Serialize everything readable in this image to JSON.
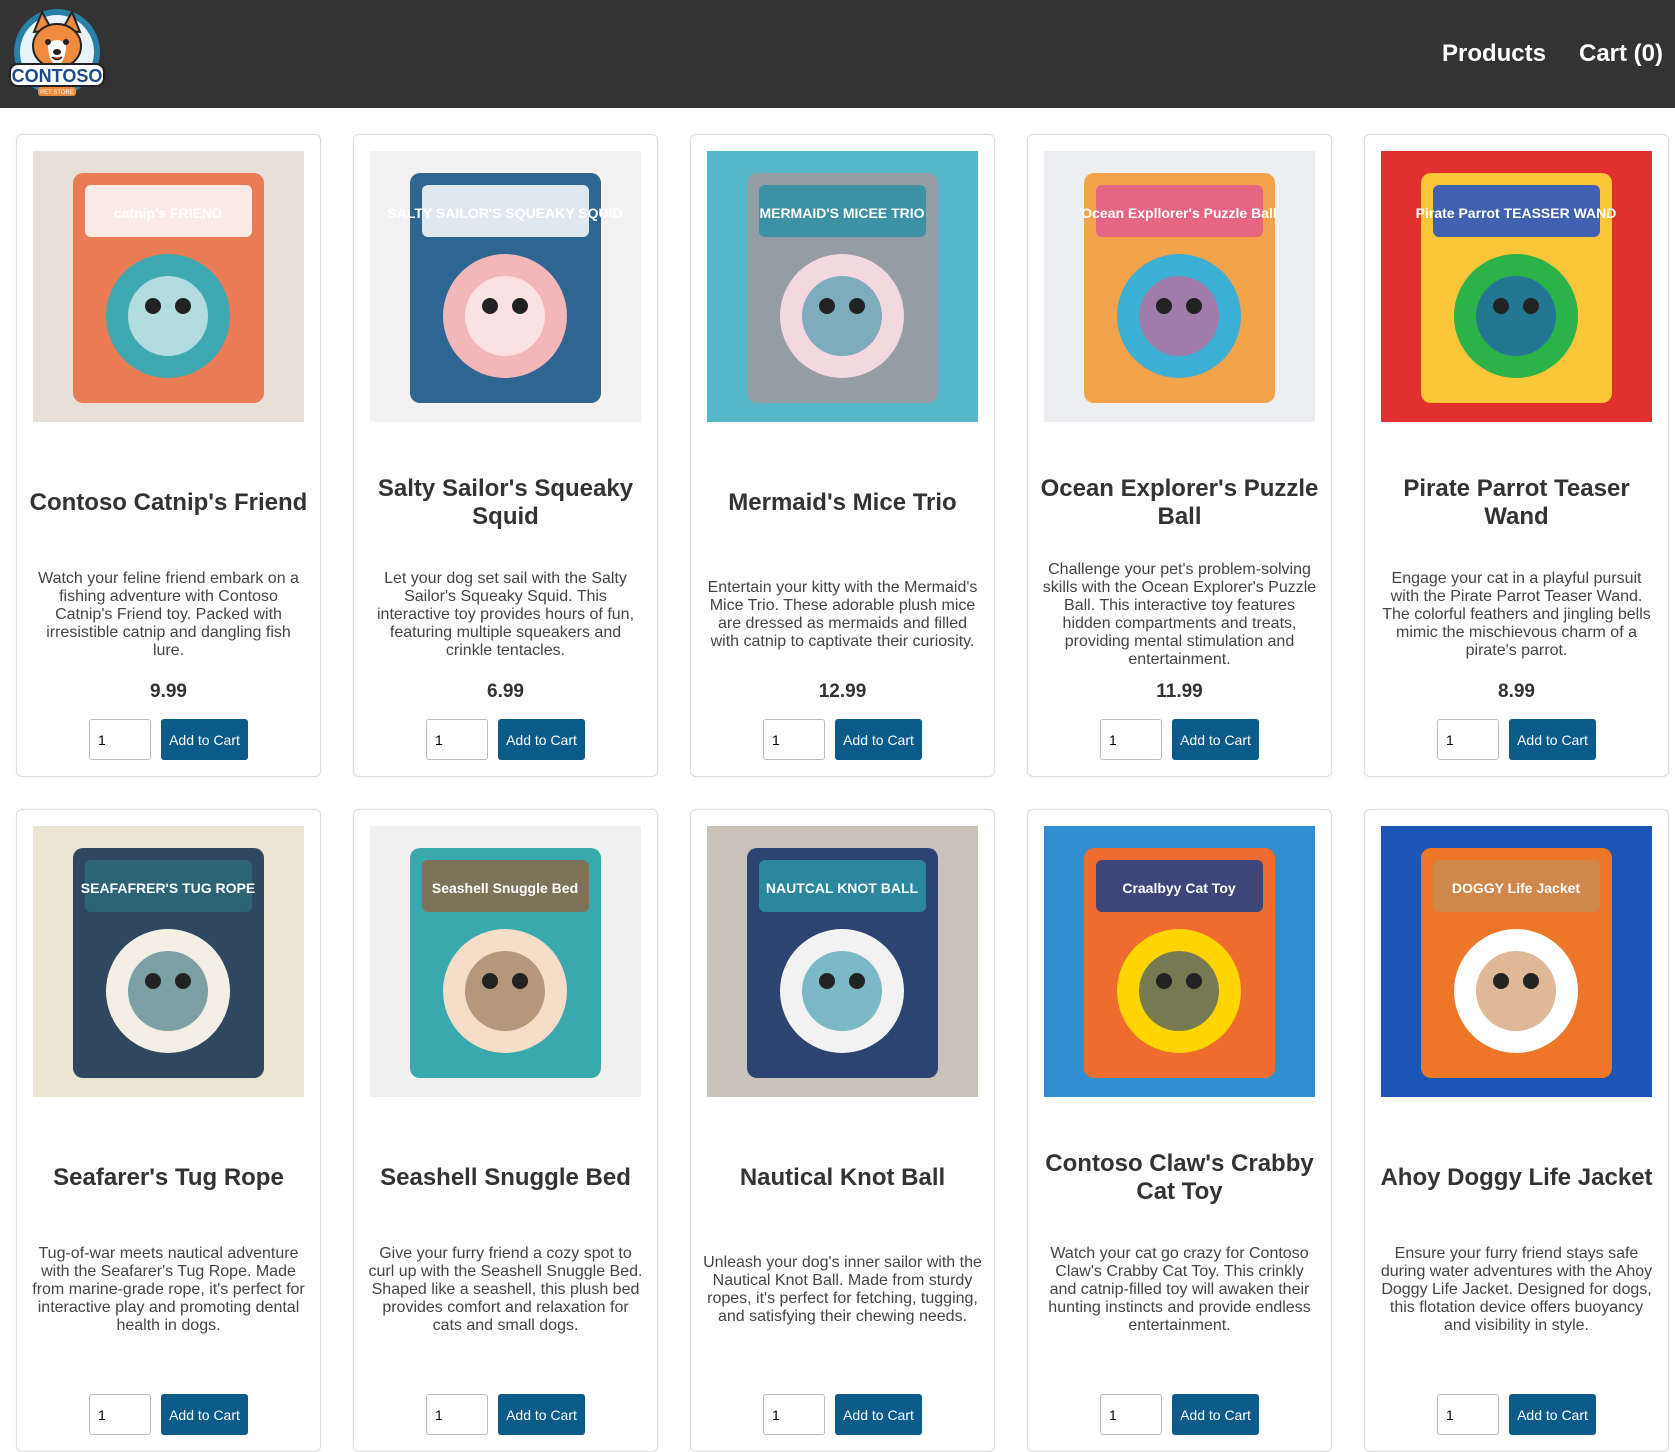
{
  "header": {
    "logo_text": "CONTOSO",
    "logo_subtext": "PET STORE",
    "nav": [
      {
        "label": "Products"
      },
      {
        "label": "Cart (0)"
      }
    ]
  },
  "products": [
    {
      "title": "Contoso Catnip's Friend",
      "description": "Watch your feline friend embark on a fishing adventure with Contoso Catnip's Friend toy. Packed with irresistible catnip and dangling fish lure.",
      "price": "9.99",
      "quantity": "1",
      "add_label": "Add to Cart",
      "image": {
        "palette": [
          "#e8e0d8",
          "#e6734a",
          "#3fa9b2",
          "#ffffff"
        ],
        "icon": "cat-ball-toy-icon",
        "package_text": "catnip's FRIEND"
      }
    },
    {
      "title": "Salty Sailor's Squeaky Squid",
      "description": "Let your dog set sail with the Salty Sailor's Squeaky Squid. This interactive toy provides hours of fun, featuring multiple squeakers and crinkle tentacles.",
      "price": "6.99",
      "quantity": "1",
      "add_label": "Add to Cart",
      "image": {
        "palette": [
          "#f2f2f2",
          "#1d5a8a",
          "#f3b6b9",
          "#ffffff"
        ],
        "icon": "squid-toy-icon",
        "package_text": "SALTY SAILOR'S SQUEAKY SQUID"
      }
    },
    {
      "title": "Mermaid's Mice Trio",
      "description": "Entertain your kitty with the Mermaid's Mice Trio. These adorable plush mice are dressed as mermaids and filled with catnip to captivate their curiosity.",
      "price": "12.99",
      "quantity": "1",
      "add_label": "Add to Cart",
      "image": {
        "palette": [
          "#55b7c9",
          "#9a9aa0",
          "#f4d8e0",
          "#2d8fa5"
        ],
        "icon": "mermaid-mice-icon",
        "package_text": "MERMAID'S MICEE TRIO"
      }
    },
    {
      "title": "Ocean Explorer's Puzzle Ball",
      "description": "Challenge your pet's problem-solving skills with the Ocean Explorer's Puzzle Ball. This interactive toy features hidden compartments and treats, providing mental stimulation and entertainment.",
      "price": "11.99",
      "quantity": "1",
      "add_label": "Add to Cart",
      "image": {
        "palette": [
          "#eceef2",
          "#f39c3c",
          "#3bb0d4",
          "#e25a8c"
        ],
        "icon": "puzzle-ball-icon",
        "package_text": "Ocean Expllorer's Puzzle Ball"
      }
    },
    {
      "title": "Pirate Parrot Teaser Wand",
      "description": "Engage your cat in a playful pursuit with the Pirate Parrot Teaser Wand. The colorful feathers and jingling bells mimic the mischievous charm of a pirate's parrot.",
      "price": "8.99",
      "quantity": "1",
      "add_label": "Add to Cart",
      "image": {
        "palette": [
          "#e0312f",
          "#ffd23a",
          "#2bb34a",
          "#1e4fc4"
        ],
        "icon": "feather-wand-icon",
        "package_text": "Pirate Parrot TEASSER WAND"
      }
    },
    {
      "title": "Seafarer's Tug Rope",
      "description": "Tug-of-war meets nautical adventure with the Seafarer's Tug Rope. Made from marine-grade rope, it's perfect for interactive play and promoting dental health in dogs.",
      "price": "",
      "quantity": "1",
      "add_label": "Add to Cart",
      "image": {
        "palette": [
          "#ece4d2",
          "#1e3b56",
          "#f4efe4",
          "#2b6a7a"
        ],
        "icon": "rope-toy-icon",
        "package_text": "SEAFAFRER'S TUG ROPE"
      }
    },
    {
      "title": "Seashell Snuggle Bed",
      "description": "Give your furry friend a cozy spot to curl up with the Seashell Snuggle Bed. Shaped like a seashell, this plush bed provides comfort and relaxation for cats and small dogs.",
      "price": "",
      "quantity": "1",
      "add_label": "Add to Cart",
      "image": {
        "palette": [
          "#f0f0f0",
          "#2aa3a8",
          "#f6ddc8",
          "#8a6a4a"
        ],
        "icon": "shell-bed-icon",
        "package_text": "Seashell Snuggle Bed"
      }
    },
    {
      "title": "Nautical Knot Ball",
      "description": "Unleash your dog's inner sailor with the Nautical Knot Ball. Made from sturdy ropes, it's perfect for fetching, tugging, and satisfying their chewing needs.",
      "price": "",
      "quantity": "1",
      "add_label": "Add to Cart",
      "image": {
        "palette": [
          "#c9c2b8",
          "#1f3a6b",
          "#f2f2f2",
          "#2a93a6"
        ],
        "icon": "knot-ball-icon",
        "package_text": "NAUTCAL KNOT BALL"
      }
    },
    {
      "title": "Contoso Claw's Crabby Cat Toy",
      "description": "Watch your cat go crazy for Contoso Claw's Crabby Cat Toy. This crinkly and catnip-filled toy will awaken their hunting instincts and provide endless entertainment.",
      "price": "",
      "quantity": "1",
      "add_label": "Add to Cart",
      "image": {
        "palette": [
          "#2f8fd1",
          "#ff6a1f",
          "#ffd400",
          "#1d3e86"
        ],
        "icon": "crab-toy-icon",
        "package_text": "Craalbyy Cat Toy"
      }
    },
    {
      "title": "Ahoy Doggy Life Jacket",
      "description": "Ensure your furry friend stays safe during water adventures with the Ahoy Doggy Life Jacket. Designed for dogs, this flotation device offers buoyancy and visibility in style.",
      "price": "",
      "quantity": "1",
      "add_label": "Add to Cart",
      "image": {
        "palette": [
          "#1c56b4",
          "#ff7a1a",
          "#ffffff",
          "#c98a52"
        ],
        "icon": "dog-life-jacket-icon",
        "package_text": "DOGGY Life Jacket"
      }
    }
  ]
}
